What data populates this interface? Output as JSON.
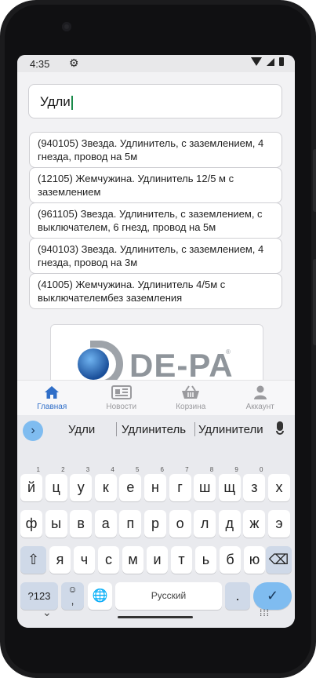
{
  "status": {
    "time": "4:35"
  },
  "search": {
    "value": "Удли"
  },
  "suggestions": [
    {
      "text": "(940105) Звезда. Удлинитель, с заземлением, 4 гнезда, провод на 5м"
    },
    {
      "text": "(12105) Жемчужина. Удлинитель 12/5 м с заземлением"
    },
    {
      "text": "(961105) Звезда. Удлинитель, с заземлением, с выключателем, 6 гнезд, провод на 5м"
    },
    {
      "text": "(940103) Звезда. Удлинитель, с заземлением, 4 гнезда, провод на 3м"
    },
    {
      "text": "(41005) Жемчужина. Удлинитель 4/5м с выключателембез заземления"
    }
  ],
  "logo": {
    "text": "DE-PA",
    "reg": "®"
  },
  "bottom_nav": [
    {
      "label": "Главная",
      "icon": "home-icon"
    },
    {
      "label": "Новости",
      "icon": "newspaper-icon"
    },
    {
      "label": "Корзина",
      "icon": "basket-icon"
    },
    {
      "label": "Аккаунт",
      "icon": "user-icon"
    }
  ],
  "keyboard": {
    "words": [
      "Удли",
      "Удлинитель",
      "Удлинители"
    ],
    "row1": [
      "й",
      "ц",
      "у",
      "к",
      "е",
      "н",
      "г",
      "ш",
      "щ",
      "з",
      "х"
    ],
    "row1_hints": [
      "1",
      "2",
      "3",
      "4",
      "5",
      "6",
      "7",
      "8",
      "9",
      "0",
      ""
    ],
    "row2": [
      "ф",
      "ы",
      "в",
      "а",
      "п",
      "р",
      "о",
      "л",
      "д",
      "ж",
      "э"
    ],
    "row3": [
      "я",
      "ч",
      "с",
      "м",
      "и",
      "т",
      "ь",
      "б",
      "ю"
    ],
    "symbols_label": "?123",
    "emoji_label": "☺",
    "comma_label": ",",
    "space_label": "Русский",
    "period_label": ".",
    "enter_label": "✓",
    "shift_label": "⇧",
    "backspace_label": "⌫",
    "globe_label": "🌐"
  },
  "colors": {
    "accent": "#2f6ec8",
    "enter_key": "#7fbcf0",
    "caret": "#1a8a4a"
  }
}
